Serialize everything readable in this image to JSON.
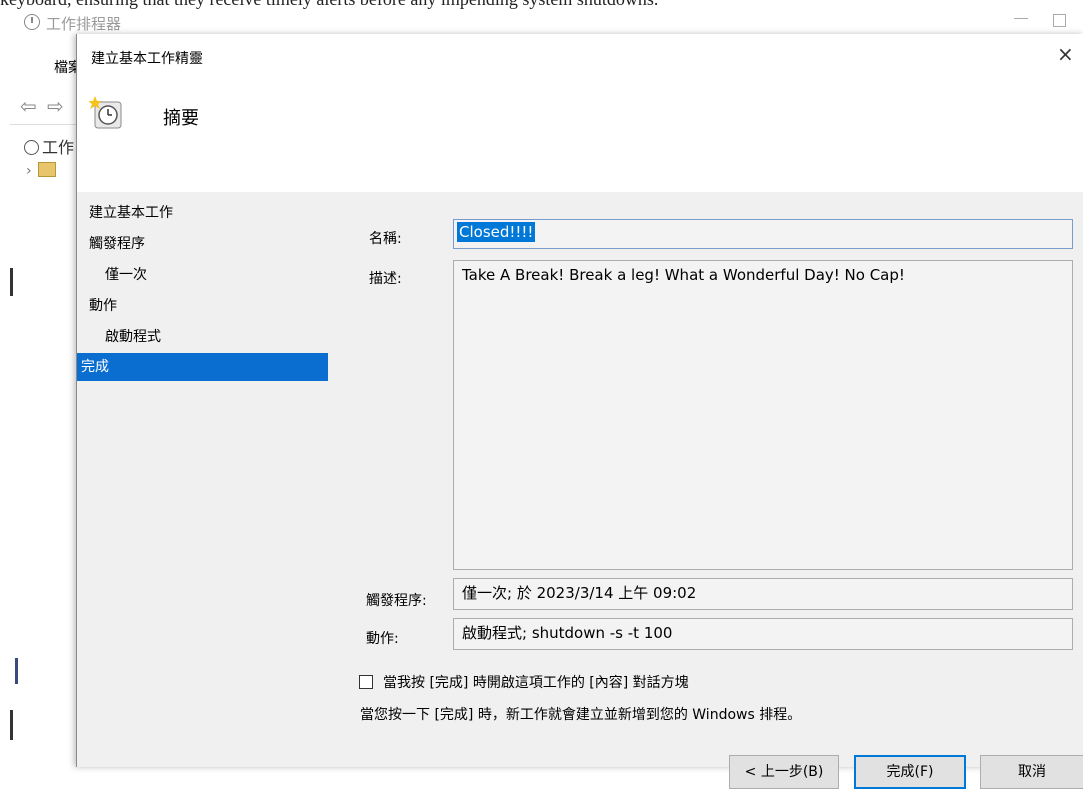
{
  "top_crop_text": "keyboard, ensuring that they receive timely alerts before any impending system shutdowns.",
  "background_window": {
    "title": "工作排程器",
    "menu_label": "檔案(F",
    "nav_arrows": "⇦ ⇨",
    "tree_item_1": "工作",
    "tree_item_2": "›"
  },
  "dialog": {
    "title": "建立基本工作精靈",
    "close_glyph": "×",
    "heading": "摘要",
    "steps": [
      {
        "label": "建立基本工作"
      },
      {
        "label": "觸發程序"
      },
      {
        "label": "僅一次"
      },
      {
        "label": "動作"
      },
      {
        "label": "啟動程式"
      },
      {
        "label": "完成"
      }
    ],
    "form": {
      "name_label": "名稱:",
      "name_value": "Closed!!!!",
      "desc_label": "描述:",
      "desc_value": "Take A Break! Break a leg! What a Wonderful Day! No Cap!",
      "trigger_label": "觸發程序:",
      "trigger_value": "僅一次; 於 2023/3/14 上午 09:02",
      "action_label": "動作:",
      "action_value": "啟動程式; shutdown -s -t 100",
      "checkbox_label": "當我按 [完成] 時開啟這項工作的 [內容] 對話方塊",
      "checkbox_checked": false,
      "info_text": "當您按一下 [完成] 時，新工作就會建立並新增到您的 Windows 排程。"
    },
    "buttons": {
      "back": "< 上一步(B)",
      "finish": "完成(F)",
      "cancel": "取消"
    }
  },
  "colors": {
    "selection_blue": "#0a6ed1",
    "body_bg": "#f0f0f0",
    "primary_border": "#0078d7"
  }
}
